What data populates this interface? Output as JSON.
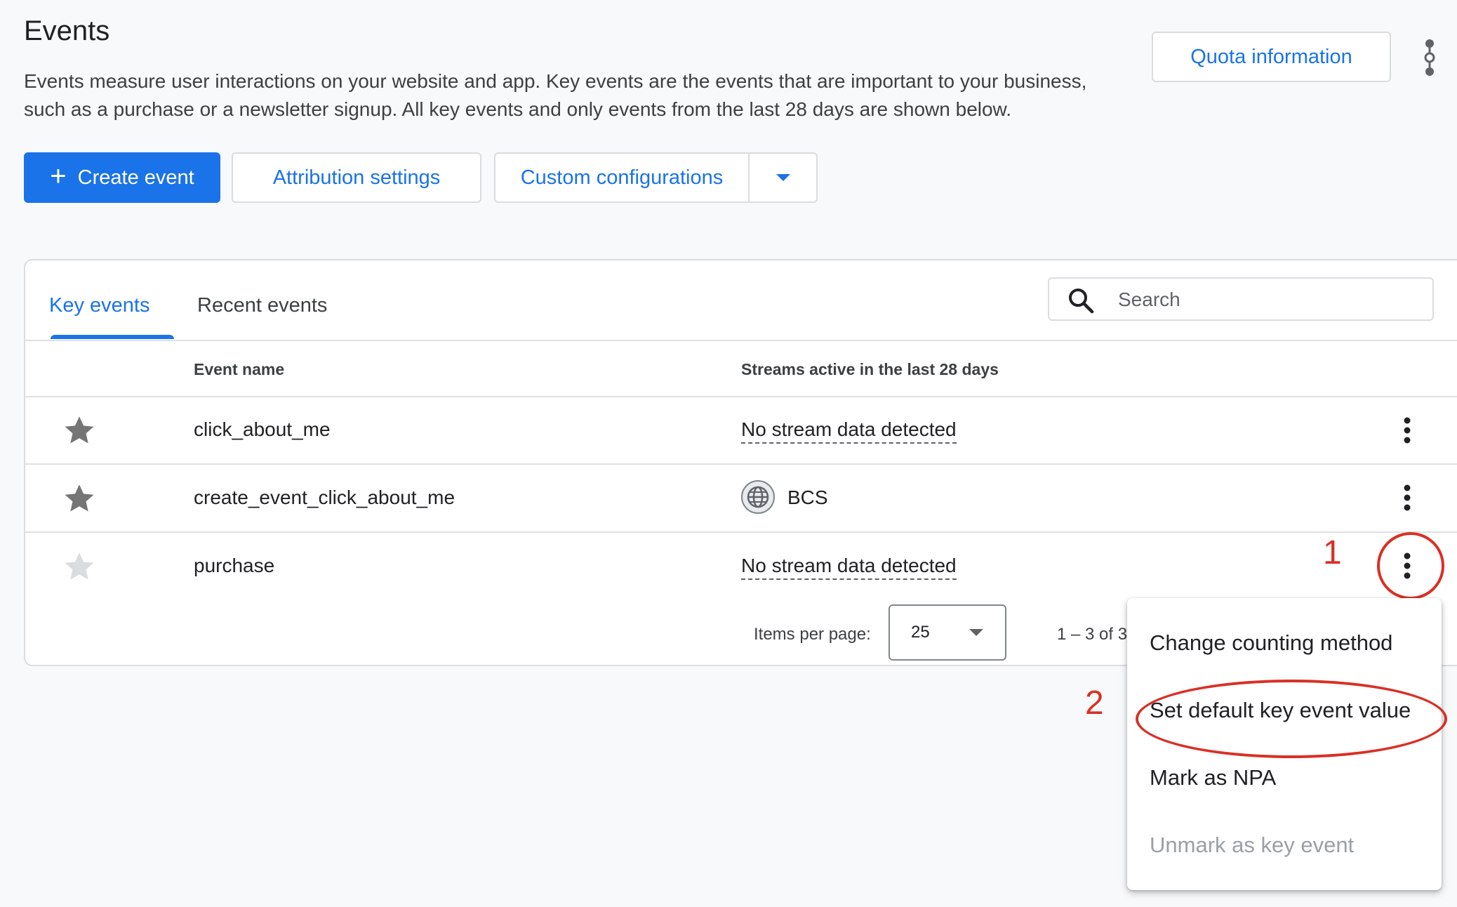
{
  "page": {
    "title": "Events",
    "description": "Events measure user interactions on your website and app. Key events are the events that are important to your business, such as a purchase or a newsletter signup. All key events and only events from the last 28 days are shown below."
  },
  "toolbar": {
    "quota_label": "Quota information",
    "create_event_label": "Create event",
    "attribution_label": "Attribution settings",
    "custom_config_label": "Custom configurations"
  },
  "tabs": [
    {
      "label": "Key events",
      "active": true
    },
    {
      "label": "Recent events",
      "active": false
    }
  ],
  "search": {
    "placeholder": "Search"
  },
  "table": {
    "columns": [
      "Event name",
      "Streams active in the last 28 days"
    ],
    "rows": [
      {
        "name": "click_about_me",
        "stream": "No stream data detected",
        "starred": true
      },
      {
        "name": "create_event_click_about_me",
        "stream": "BCS",
        "starred": true
      },
      {
        "name": "purchase",
        "stream": "No stream data detected",
        "starred": false
      }
    ]
  },
  "pagination": {
    "items_per_page_label": "Items per page:",
    "items_per_page_value": "25",
    "range_text": "1 – 3 of 3"
  },
  "context_menu": {
    "items": [
      {
        "label": "Change counting method",
        "enabled": true
      },
      {
        "label": "Set default key event value",
        "enabled": true
      },
      {
        "label": "Mark as NPA",
        "enabled": true
      },
      {
        "label": "Unmark as key event",
        "enabled": false
      }
    ]
  },
  "annotations": [
    "1",
    "2"
  ],
  "colors": {
    "accent": "#1a73e8",
    "star_active": "#757575",
    "star_inactive": "#dadce0",
    "annotation": "#d93025"
  }
}
